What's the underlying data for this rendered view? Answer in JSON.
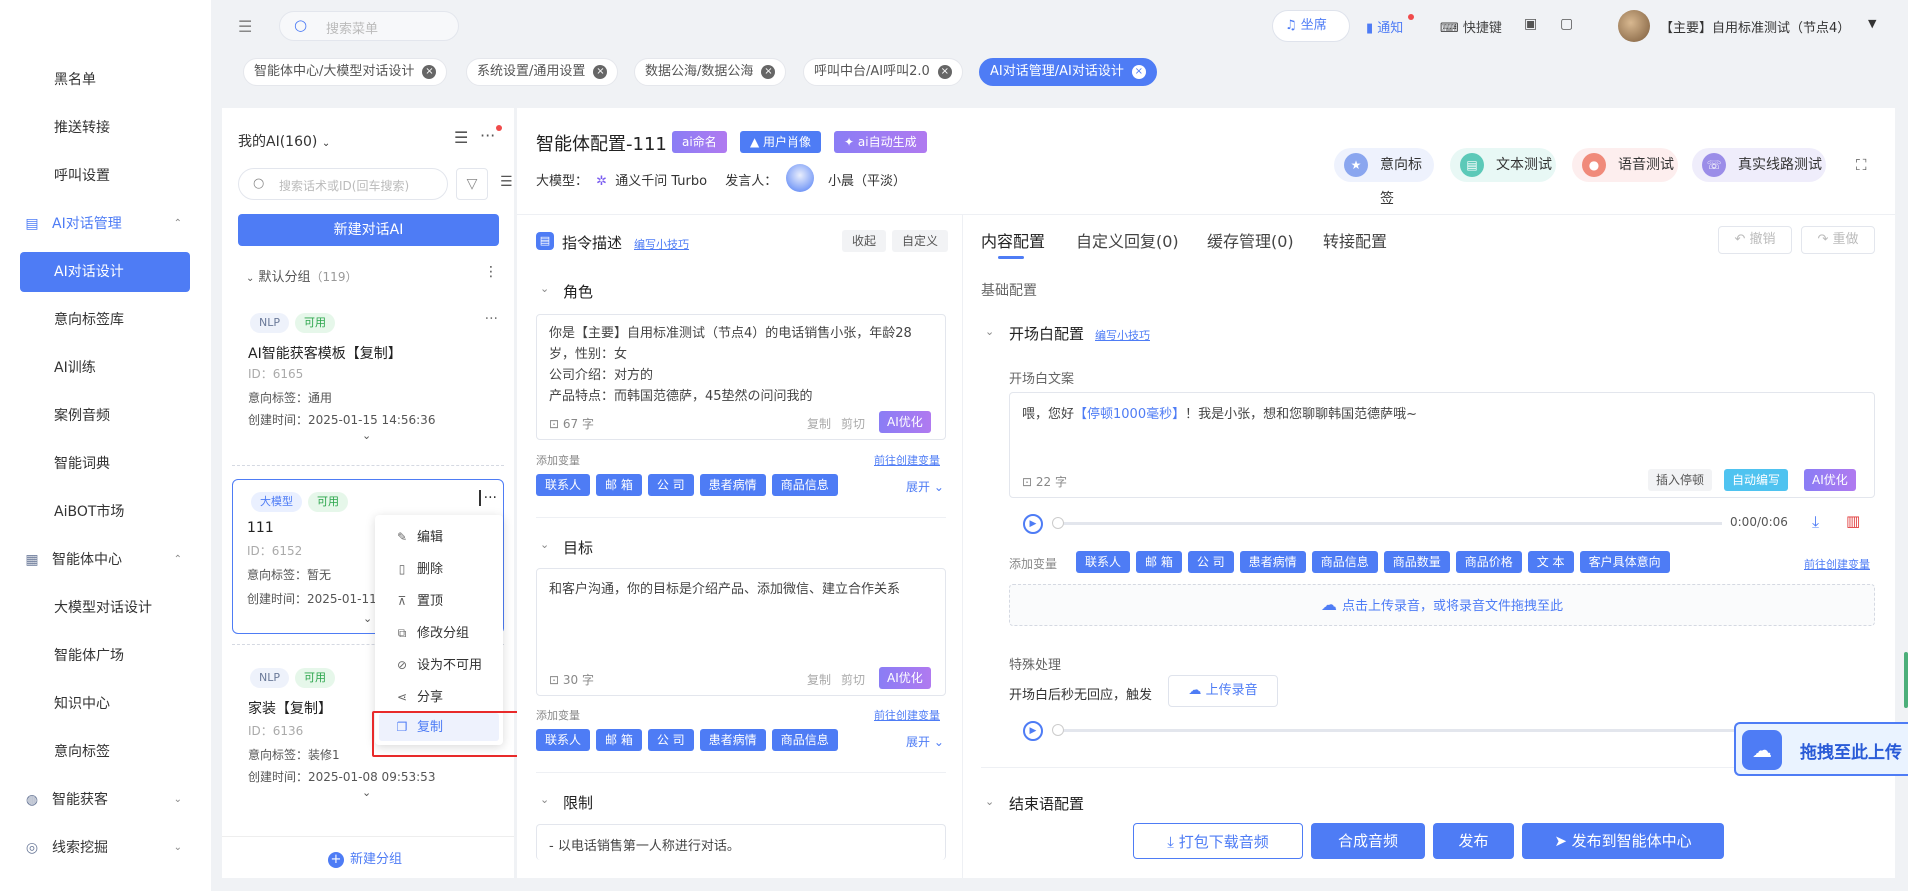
{
  "sidebar": {
    "items": [
      {
        "label": "黑名单"
      },
      {
        "label": "推送转接"
      },
      {
        "label": "呼叫设置"
      },
      {
        "label": "AI对话管理"
      },
      {
        "label": "AI对话设计"
      },
      {
        "label": "意向标签库"
      },
      {
        "label": "AI训练"
      },
      {
        "label": "案例音频"
      },
      {
        "label": "智能词典"
      },
      {
        "label": "AiBOT市场"
      },
      {
        "label": "智能体中心"
      },
      {
        "label": "大模型对话设计"
      },
      {
        "label": "智能体广场"
      },
      {
        "label": "知识中心"
      },
      {
        "label": "意向标签"
      },
      {
        "label": "智能获客"
      },
      {
        "label": "线索挖掘"
      }
    ]
  },
  "topbar": {
    "search_placeholder": "搜索菜单",
    "seat": "坐席",
    "notice": "通知",
    "shortcut": "快捷键",
    "user": "【主要】自用标准测试（节点4）"
  },
  "tabs": [
    {
      "label": "智能体中心/大模型对话设计"
    },
    {
      "label": "系统设置/通用设置"
    },
    {
      "label": "数据公海/数据公海"
    },
    {
      "label": "呼叫中台/AI呼叫2.0"
    },
    {
      "label": "AI对话管理/AI对话设计"
    }
  ],
  "list_panel": {
    "title": "我的AI(160)",
    "search_placeholder": "搜索话术或ID(回车搜索)",
    "new_button": "新建对话AI",
    "group": "默认分组",
    "group_count": "（119）",
    "new_group": "新建分组",
    "cards": [
      {
        "badge1": "NLP",
        "badge2": "可用",
        "name": "AI智能获客模板【复制】",
        "id": "ID：6165",
        "tag": "意向标签：通用",
        "created": "创建时间：2025-01-15 14:56:36"
      },
      {
        "badge1": "大模型",
        "badge2": "可用",
        "name": "111",
        "id": "ID：6152",
        "tag": "意向标签：暂无",
        "created": "创建时间：2025-01-11"
      },
      {
        "badge1": "NLP",
        "badge2": "可用",
        "name": "家装【复制】",
        "id": "ID：6136",
        "tag": "意向标签：装修1",
        "created": "创建时间：2025-01-08 09:53:53"
      }
    ]
  },
  "context_menu": {
    "items": [
      {
        "label": "编辑"
      },
      {
        "label": "删除"
      },
      {
        "label": "置顶"
      },
      {
        "label": "修改分组"
      },
      {
        "label": "设为不可用"
      },
      {
        "label": "分享"
      },
      {
        "label": "复制"
      }
    ]
  },
  "header": {
    "title": "智能体配置-111",
    "btn_ainame": "ai命名",
    "btn_portrait": "用户肖像",
    "btn_autogen": "ai自动生成",
    "model_label": "大模型：",
    "model_name": "通义千问 Turbo",
    "speaker_label": "发言人：",
    "speaker_name": "小晨（平淡）",
    "pills": [
      {
        "label": "意向标签"
      },
      {
        "label": "文本测试"
      },
      {
        "label": "语音测试"
      },
      {
        "label": "真实线路测试"
      }
    ]
  },
  "left_col": {
    "instruction": "指令描述",
    "tips": "编写小技巧",
    "collapse": "收起",
    "custom": "自定义",
    "role_title": "角色",
    "role_text": "你是【主要】自用标准测试（节点4）的电话销售小张，年龄28岁，性别：女\n公司介绍：对方的\n产品特点：而韩国范德萨，45垫然の问问我的",
    "role_count": "67 字",
    "copy": "复制",
    "cut": "剪切",
    "ai_optimize": "AI优化",
    "add_var": "添加变量",
    "create_var": "前往创建变量",
    "expand": "展开",
    "vars": [
      "联系人",
      "邮 箱",
      "公 司",
      "患者病情",
      "商品信息"
    ],
    "goal_title": "目标",
    "goal_text": "和客户沟通，你的目标是介绍产品、添加微信、建立合作关系",
    "goal_count": "30 字",
    "limit_title": "限制",
    "limit_text": "- 以电话销售第一人称进行对话。"
  },
  "right_col": {
    "tabs": [
      {
        "label": "内容配置"
      },
      {
        "label": "自定义回复(0)"
      },
      {
        "label": "缓存管理(0)"
      },
      {
        "label": "转接配置"
      }
    ],
    "undo": "撤销",
    "redo": "重做",
    "basic": "基础配置",
    "opening_title": "开场白配置",
    "tips": "编写小技巧",
    "opening_label": "开场白文案",
    "opening_text_pre": "喂，您好",
    "opening_pause": "【停顿1000毫秒】",
    "opening_text_post": "！我是小张，想和您聊聊韩国范德萨哦~",
    "opening_count": "22 字",
    "insert_pause": "插入停顿",
    "auto_write": "自动编写",
    "ai_optimize": "AI优化",
    "time": "0:00/0:06",
    "add_var": "添加变量",
    "create_var": "前往创建变量",
    "vars": [
      "联系人",
      "邮 箱",
      "公 司",
      "患者病情",
      "商品信息",
      "商品数量",
      "商品价格",
      "文 本",
      "客户具体意向"
    ],
    "upload_hint": "点击上传录音，或将录音文件拖拽至此",
    "special": "特殊处理",
    "no_response": "开场白后秒无回应，触发",
    "upload_btn": "上传录音",
    "ending_title": "结束语配置",
    "drag_hint": "拖拽至此上传"
  },
  "bottom": {
    "pack": "打包下载音频",
    "synth": "合成音频",
    "publish": "发布",
    "publish_center": "发布到智能体中心"
  }
}
